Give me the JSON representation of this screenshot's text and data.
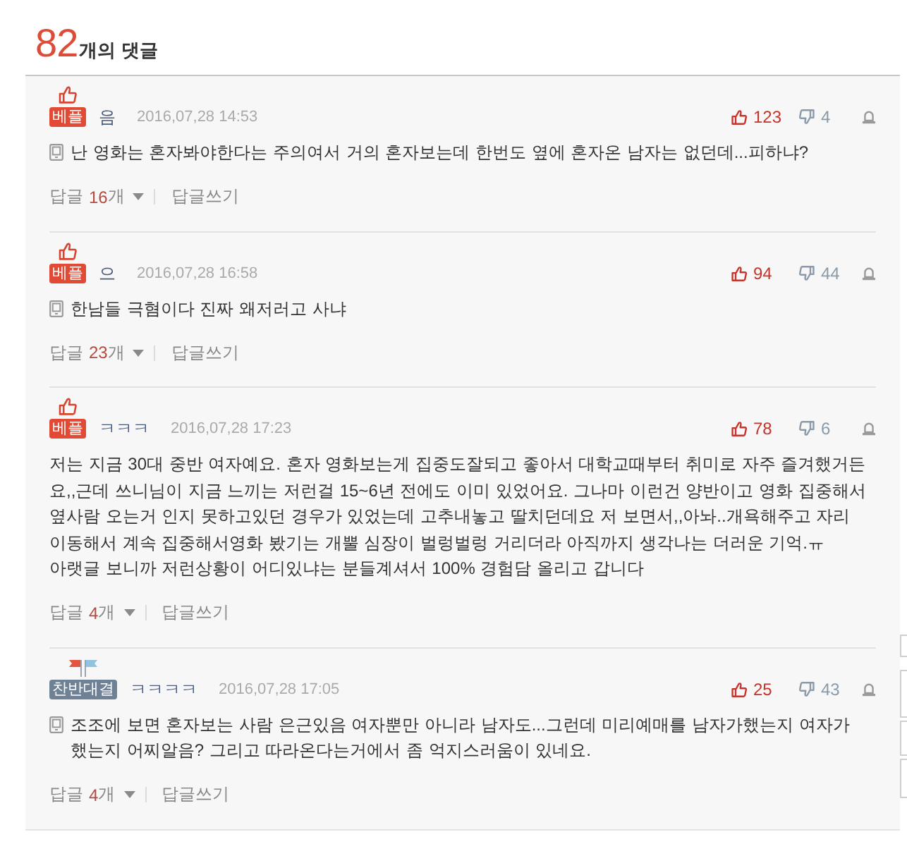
{
  "header": {
    "count": "82",
    "label": "개의 댓글"
  },
  "comments": [
    {
      "badge": {
        "kind": "best",
        "label": "베플"
      },
      "author": "음",
      "date": "2016,07,28 14:53",
      "likes": "123",
      "dislikes": "4",
      "mobile": true,
      "text": "난 영화는 혼자봐야한다는 주의여서 거의 혼자보는데 한번도 옆에 혼자온 남자는 없던데...피하냐?",
      "replies": {
        "label": "답글",
        "count": "16",
        "unit": "개"
      },
      "write_reply": "답글쓰기"
    },
    {
      "badge": {
        "kind": "best",
        "label": "베플"
      },
      "author": "으",
      "date": "2016,07,28 16:58",
      "likes": "94",
      "dislikes": "44",
      "mobile": true,
      "text": "한남들 극혐이다 진짜 왜저러고 사냐",
      "replies": {
        "label": "답글",
        "count": "23",
        "unit": "개"
      },
      "write_reply": "답글쓰기"
    },
    {
      "badge": {
        "kind": "best",
        "label": "베플"
      },
      "author": "ㅋㅋㅋ",
      "date": "2016,07,28 17:23",
      "likes": "78",
      "dislikes": "6",
      "mobile": false,
      "text": "저는 지금 30대 중반 여자예요. 혼자 영화보는게 집중도잘되고 좋아서 대학교때부터 취미로 자주 즐겨했거든요,,근데 쓰니님이 지금 느끼는 저런걸 15~6년 전에도 이미 있었어요. 그나마 이런건 양반이고 영화 집중해서 옆사람 오는거 인지 못하고있던 경우가 있었는데 고추내놓고 딸치던데요 저 보면서,,아놔..개욕해주고 자리이동해서 계속 집중해서영화 봤기는 개뿔 심장이 벌렁벌렁 거리더라 아직까지 생각나는 더러운 기억.ㅠ\n아랫글 보니까 저런상황이 어디있냐는 분들계셔서 100% 경험담 올리고 갑니다",
      "replies": {
        "label": "답글",
        "count": "4",
        "unit": "개"
      },
      "write_reply": "답글쓰기"
    },
    {
      "badge": {
        "kind": "debate",
        "label": "찬반대결"
      },
      "author": "ㅋㅋㅋㅋ",
      "date": "2016,07,28 17:05",
      "likes": "25",
      "dislikes": "43",
      "mobile": true,
      "text": "조조에 보면 혼자보는 사람 은근있음 여자뿐만 아니라 남자도...그런데 미리예매를 남자가했는지 여자가 했는지 어찌알음? 그리고 따라온다는거에서 좀 억지스러움이 있네요.",
      "replies": {
        "label": "답글",
        "count": "4",
        "unit": "개"
      },
      "write_reply": "답글쓰기"
    }
  ]
}
